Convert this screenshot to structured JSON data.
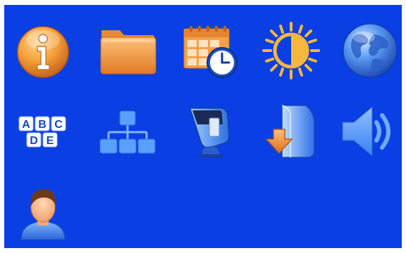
{
  "screen": {
    "background_color": "#0a3fe3",
    "icons": [
      {
        "name": "info-icon"
      },
      {
        "name": "folder-icon"
      },
      {
        "name": "calendar-clock-icon"
      },
      {
        "name": "brightness-icon"
      },
      {
        "name": "globe-icon"
      },
      {
        "name": "abc-keyboard-icon",
        "letters": [
          "A",
          "B",
          "C",
          "D",
          "E"
        ]
      },
      {
        "name": "network-hierarchy-icon"
      },
      {
        "name": "card-reader-icon"
      },
      {
        "name": "download-icon"
      },
      {
        "name": "speaker-volume-icon"
      },
      {
        "name": "user-icon"
      }
    ]
  }
}
